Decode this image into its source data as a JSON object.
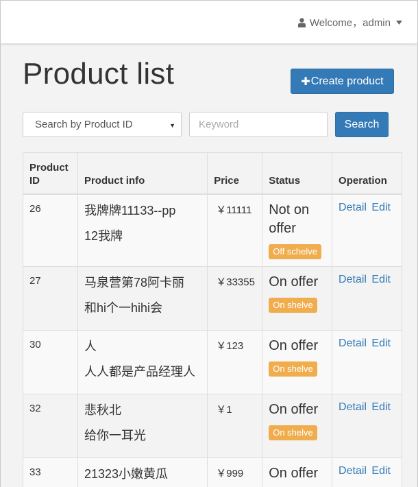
{
  "header": {
    "welcome_text": "Welcome，admin",
    "user_icon": "user-icon",
    "caret_icon": "caret-down-icon"
  },
  "page": {
    "title": "Product list",
    "create_button": "Create product"
  },
  "search": {
    "select_value": "Search by Product ID",
    "keyword_placeholder": "Keyword",
    "keyword_value": "",
    "button": "Search"
  },
  "table": {
    "headers": {
      "id_line1": "Product",
      "id_line2": "ID",
      "info": "Product info",
      "price": "Price",
      "status": "Status",
      "operation": "Operation"
    },
    "rows": [
      {
        "id": "26",
        "name": "我牌牌11133--pp",
        "subtitle": "12我牌",
        "price": "￥11111",
        "status_line1": "Not on",
        "status_line2": "offer",
        "badge": "Off schelve",
        "detail": "Detail",
        "edit": "Edit"
      },
      {
        "id": "27",
        "name": "马泉营第78阿卡丽",
        "subtitle": "和hi个一hihi会",
        "price": "￥33355",
        "status_line1": "On offer",
        "status_line2": "",
        "badge": "On shelve",
        "detail": "Detail",
        "edit": "Edit"
      },
      {
        "id": "30",
        "name": "人",
        "subtitle": "人人都是产品经理人",
        "price": "￥123",
        "status_line1": "On offer",
        "status_line2": "",
        "badge": "On shelve",
        "detail": "Detail",
        "edit": "Edit"
      },
      {
        "id": "32",
        "name": "悲秋北",
        "subtitle": "给你一耳光",
        "price": "￥1",
        "status_line1": "On offer",
        "status_line2": "",
        "badge": "On shelve",
        "detail": "Detail",
        "edit": "Edit"
      },
      {
        "id": "33",
        "name": "21323小嫩黄瓜",
        "subtitle": "",
        "price": "￥999",
        "status_line1": "On offer",
        "status_line2": "",
        "badge": "",
        "detail": "Detail",
        "edit": "Edit"
      }
    ]
  },
  "colors": {
    "primary": "#337ab7",
    "badge": "#f0ad4e",
    "background": "#f3f3f3"
  }
}
